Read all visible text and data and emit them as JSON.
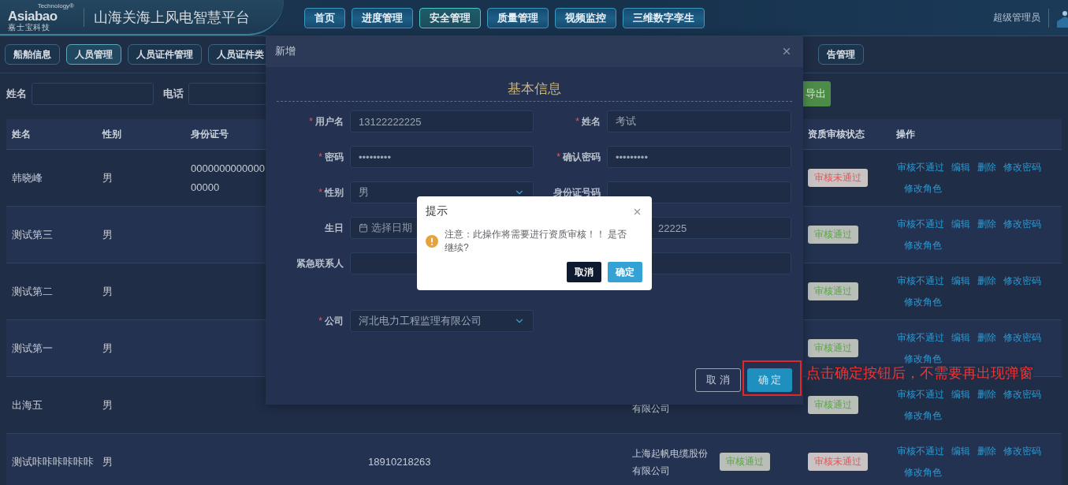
{
  "header": {
    "logo": {
      "brand": "Asiabao",
      "trademark": "Technology®",
      "subtitle": "嘉 士 宝 科 技"
    },
    "title": "山海关海上风电智慧平台",
    "nav": [
      {
        "label": "首页",
        "selected": false
      },
      {
        "label": "进度管理",
        "selected": false
      },
      {
        "label": "安全管理",
        "selected": true
      },
      {
        "label": "质量管理",
        "selected": false
      },
      {
        "label": "视频监控",
        "selected": false
      },
      {
        "label": "三维数字孪生",
        "selected": false
      }
    ],
    "user": "超级管理员"
  },
  "sub_tabs": [
    {
      "label": "船舶信息",
      "selected": false
    },
    {
      "label": "人员管理",
      "selected": true
    },
    {
      "label": "人员证件管理",
      "selected": false
    },
    {
      "label": "人员证件类",
      "selected": false
    },
    {
      "label": "告管理",
      "selected": false
    }
  ],
  "search": [
    {
      "label": "姓名"
    },
    {
      "label": "电话"
    }
  ],
  "export_button": "导出",
  "table": {
    "columns": {
      "name": "姓名",
      "gender": "性别",
      "id_number": "身份证号",
      "status": "资质审核状态",
      "actions": "操作"
    },
    "rows": [
      {
        "name": "韩晓峰",
        "gender": "男",
        "id_number": "000000000000000000",
        "status": {
          "label": "审核未通过",
          "kind": "fail"
        },
        "actions": [
          "审核不通过",
          "编辑",
          "删除",
          "修改密码",
          "修改角色"
        ]
      },
      {
        "name": "测试第三",
        "gender": "男",
        "status": {
          "label": "审核通过",
          "kind": "pass"
        },
        "actions": [
          "审核不通过",
          "编辑",
          "删除",
          "修改密码",
          "修改角色"
        ]
      },
      {
        "name": "测试第二",
        "gender": "男",
        "status": {
          "label": "审核通过",
          "kind": "pass"
        },
        "actions": [
          "审核不通过",
          "编辑",
          "删除",
          "修改密码",
          "修改角色"
        ]
      },
      {
        "name": "测试第一",
        "gender": "男",
        "status": {
          "label": "审核通过",
          "kind": "pass"
        },
        "actions": [
          "审核不通过",
          "编辑",
          "删除",
          "修改密码",
          "修改角色"
        ]
      },
      {
        "name": "出海五",
        "gender": "男",
        "company": "有限公司",
        "company_cut": true,
        "status": {
          "label": "审核通过",
          "kind": "pass"
        },
        "actions": [
          "审核不通过",
          "编辑",
          "删除",
          "修改密码",
          "修改角色"
        ]
      },
      {
        "name": "测试咔咔咔咔咔咔",
        "gender": "男",
        "phone": "18910218263",
        "company": "上海起帆电缆股份有限公司",
        "company_cut": false,
        "tag": {
          "label": "审核通过",
          "kind": "pass"
        },
        "status": {
          "label": "审核未通过",
          "kind": "fail"
        },
        "actions": [
          "审核不通过",
          "编辑",
          "删除",
          "修改密码",
          "修改角色"
        ]
      }
    ]
  },
  "dialog": {
    "title": "新增",
    "section": "基本信息",
    "rows": [
      [
        {
          "label": "用户名",
          "required_mark": "*",
          "kind": "text",
          "value": "13122222225"
        },
        {
          "label": "姓名",
          "required_mark": "*",
          "kind": "text",
          "value": "考试"
        }
      ],
      [
        {
          "label": "密码",
          "required_mark": "*",
          "kind": "text",
          "value": "•••••••••"
        },
        {
          "label": "确认密码",
          "required_mark": "*",
          "kind": "text",
          "value": "•••••••••"
        }
      ],
      [
        {
          "label": "性别",
          "required_mark": "*",
          "kind": "select",
          "value": "男"
        },
        {
          "label": "身份证号码",
          "kind": "text"
        }
      ],
      [
        {
          "label": "生日",
          "kind": "date",
          "placeholder": "选择日期"
        },
        {
          "kind": "text_cut",
          "value": "22225"
        }
      ],
      [
        {
          "label": "紧急联系人",
          "kind": "text"
        },
        {
          "kind": "text"
        }
      ],
      [
        {
          "label": "公司",
          "required_mark": "*",
          "kind": "select",
          "value": "河北电力工程监理有限公司"
        }
      ]
    ],
    "buttons": [
      {
        "label": "取 消",
        "kind": "secondary"
      },
      {
        "label": "确 定",
        "kind": "primary"
      }
    ]
  },
  "message_box": {
    "title": "提示",
    "message": "注意：此操作将需要进行资质审核！！ 是否继续?",
    "buttons": [
      {
        "label": "取消",
        "kind": "secondary"
      },
      {
        "label": "确定",
        "kind": "primary"
      }
    ]
  },
  "annotation": "点击确定按钮后，不需要再出现弹窗"
}
